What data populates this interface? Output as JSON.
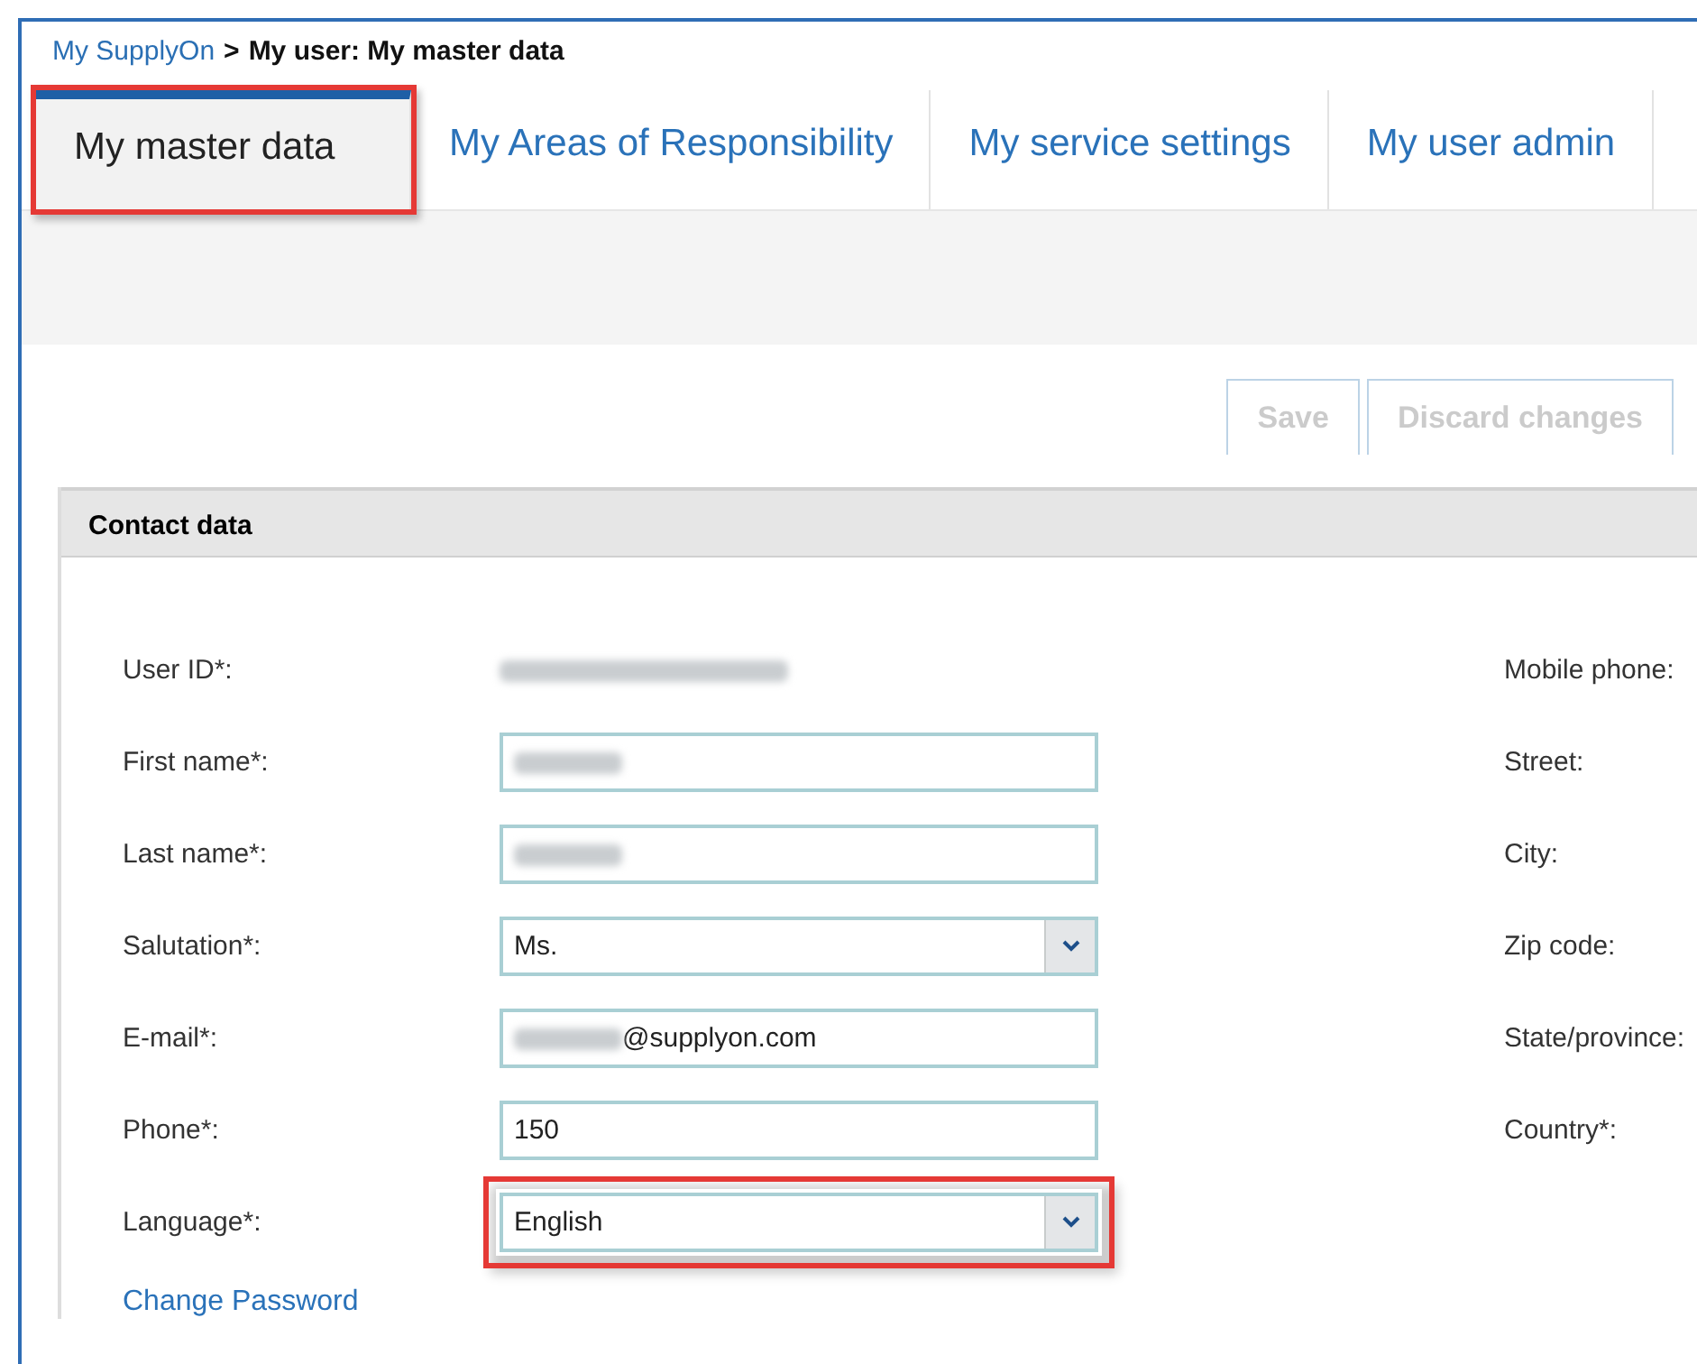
{
  "breadcrumb": {
    "link": "My SupplyOn",
    "separator": ">",
    "current": "My user: My master data"
  },
  "tabs": [
    {
      "label": "My master data",
      "selected": true,
      "highlighted": true
    },
    {
      "label": "My Areas of Responsibility",
      "selected": false,
      "highlighted": false
    },
    {
      "label": "My service settings",
      "selected": false,
      "highlighted": false
    },
    {
      "label": "My user admin",
      "selected": false,
      "highlighted": false
    }
  ],
  "actions": [
    {
      "label": "Save",
      "disabled": true
    },
    {
      "label": "Discard changes",
      "disabled": true
    }
  ],
  "panel": {
    "title": "Contact data",
    "fields": [
      {
        "label": "User ID*:",
        "kind": "static",
        "redacted": true,
        "highlighted": false
      },
      {
        "label": "First name*:",
        "kind": "text",
        "redacted": true,
        "highlighted": false
      },
      {
        "label": "Last name*:",
        "kind": "text",
        "redacted": true,
        "highlighted": false
      },
      {
        "label": "Salutation*:",
        "kind": "select",
        "value": "Ms.",
        "redacted": false,
        "highlighted": false
      },
      {
        "label": "E-mail*:",
        "kind": "text",
        "value": "@supplyon.com",
        "redacted": true,
        "highlighted": false
      },
      {
        "label": "Phone*:",
        "kind": "text",
        "value": "150",
        "redacted": false,
        "highlighted": false
      },
      {
        "label": "Language*:",
        "kind": "select",
        "value": "English",
        "redacted": false,
        "highlighted": true
      }
    ],
    "link": "Change Password",
    "right_labels": [
      "Mobile phone:",
      "Street:",
      "City:",
      "Zip code:",
      "State/province:",
      "Country*:"
    ]
  }
}
